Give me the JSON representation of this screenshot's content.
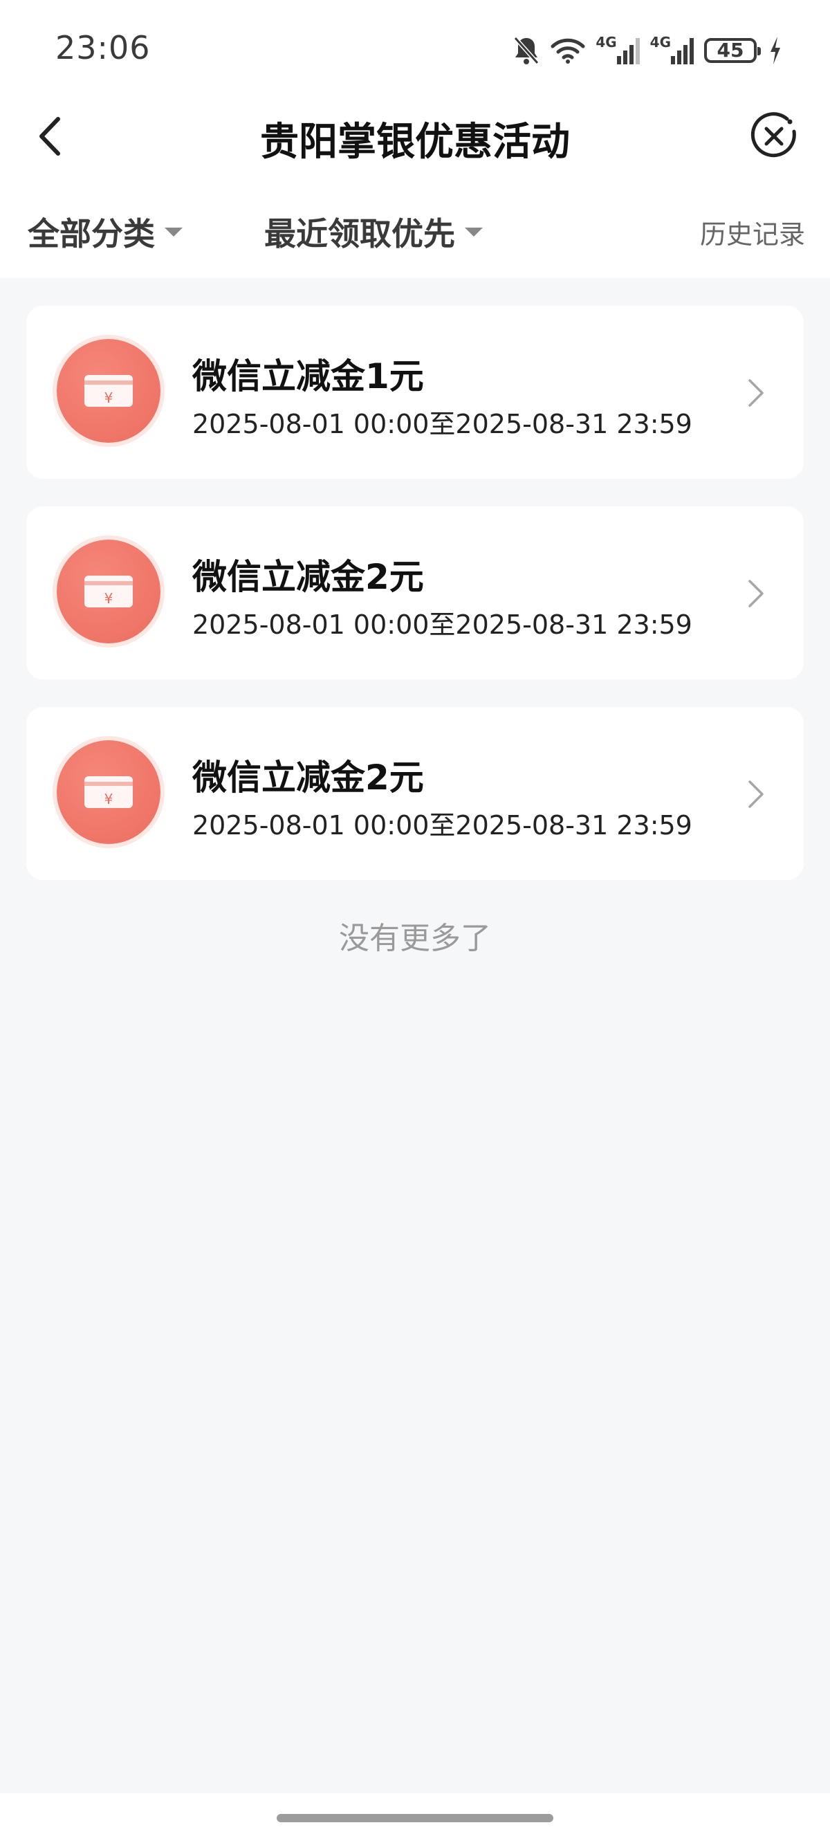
{
  "status_bar": {
    "time": "23:06",
    "network_1": "4G",
    "network_2": "4G",
    "battery": "45",
    "icons": [
      "bell-off-icon",
      "wifi-icon",
      "signal-icon",
      "signal-icon",
      "battery-icon",
      "charging-icon"
    ]
  },
  "nav": {
    "title": "贵阳掌银优惠活动",
    "back_icon": "chevron-left-icon",
    "close_icon": "close-circle-icon"
  },
  "filters": {
    "category": "全部分类",
    "sort": "最近领取优先",
    "history": "历史记录"
  },
  "coupons": [
    {
      "title": "微信立减金1元",
      "date_range": "2025-08-01 00:00至2025-08-31 23:59"
    },
    {
      "title": "微信立减金2元",
      "date_range": "2025-08-01 00:00至2025-08-31 23:59"
    },
    {
      "title": "微信立减金2元",
      "date_range": "2025-08-01 00:00至2025-08-31 23:59"
    }
  ],
  "list_end_text": "没有更多了",
  "colors": {
    "accent": "#ec6d5f",
    "background": "#f6f7f9",
    "card": "#ffffff"
  }
}
